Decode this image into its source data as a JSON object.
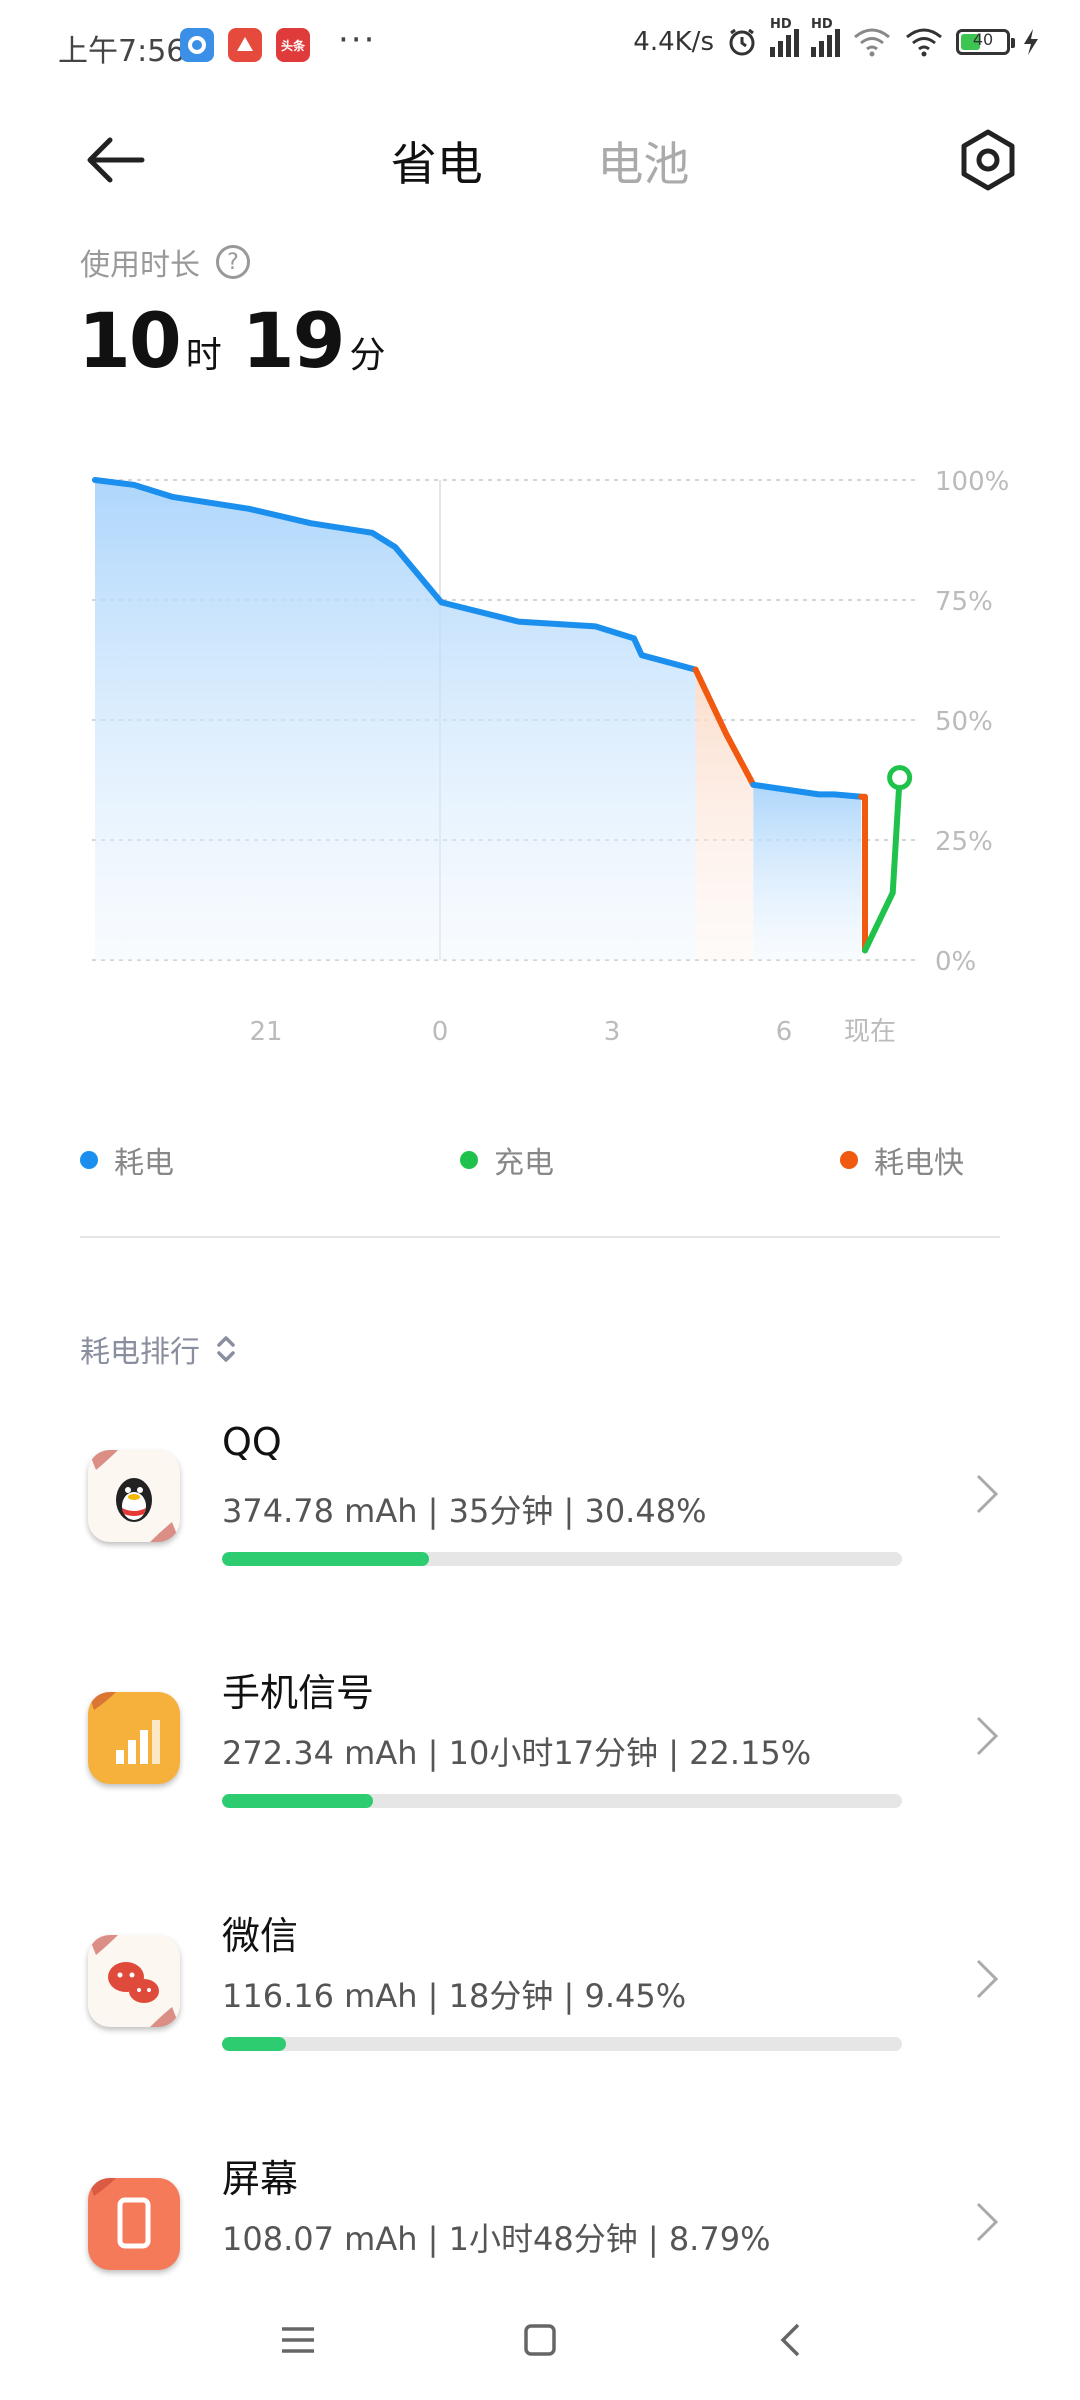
{
  "status_bar": {
    "time": "上午7:56",
    "network_speed": "4.4K/s",
    "battery_level": "40",
    "hd_label": "HD",
    "notification_apps": [
      {
        "icon": "browser-icon",
        "color": "#3b8fe6",
        "label": ""
      },
      {
        "icon": "game-icon",
        "color": "#e64a3c",
        "label": ""
      },
      {
        "icon": "toutiao-icon",
        "color": "#e03b3b",
        "label": "头条"
      }
    ],
    "more_indicator": "···"
  },
  "header": {
    "tabs": [
      {
        "label": "省电",
        "active": true
      },
      {
        "label": "电池",
        "active": false
      }
    ]
  },
  "usage": {
    "label": "使用时长",
    "hours": "10",
    "hours_unit": "时",
    "minutes": "19",
    "minutes_unit": "分"
  },
  "chart_data": {
    "type": "area",
    "y_ticks": [
      "100%",
      "75%",
      "50%",
      "25%",
      "0%"
    ],
    "x_ticks": [
      "21",
      "0",
      "3",
      "6",
      "现在"
    ],
    "ylim": [
      0,
      100
    ],
    "series": [
      {
        "name": "耗电",
        "color": "#1a8fee",
        "points": [
          [
            0,
            100
          ],
          [
            0.05,
            99
          ],
          [
            0.1,
            96.5
          ],
          [
            0.2,
            94
          ],
          [
            0.28,
            91
          ],
          [
            0.36,
            89
          ],
          [
            0.39,
            86
          ],
          [
            0.45,
            74.5
          ],
          [
            0.55,
            70.5
          ],
          [
            0.65,
            69.5
          ],
          [
            0.7,
            67
          ],
          [
            0.71,
            63.5
          ],
          [
            0.78,
            60.5
          ]
        ]
      },
      {
        "name": "耗电快",
        "color": "#f0590f",
        "points": [
          [
            0.78,
            60.5
          ],
          [
            0.82,
            47
          ],
          [
            0.855,
            36.5
          ]
        ]
      },
      {
        "name": "耗电",
        "color": "#1a8fee",
        "points": [
          [
            0.855,
            36.5
          ],
          [
            0.94,
            34.5
          ],
          [
            0.96,
            34.5
          ],
          [
            0.995,
            34
          ]
        ]
      },
      {
        "name": "耗电快",
        "color": "#f0590f",
        "points": [
          [
            0.995,
            34
          ],
          [
            1.0,
            34
          ],
          [
            1.0,
            2
          ]
        ]
      },
      {
        "name": "充电",
        "color": "#1fc24a",
        "points": [
          [
            1.0,
            2
          ],
          [
            1.036,
            14
          ],
          [
            1.045,
            38
          ]
        ]
      }
    ]
  },
  "legend": [
    {
      "label": "耗电",
      "color": "#1a8fee"
    },
    {
      "label": "充电",
      "color": "#1fc24a"
    },
    {
      "label": "耗电快",
      "color": "#f0590f"
    }
  ],
  "ranking": {
    "title": "耗电排行",
    "apps": [
      {
        "name": "QQ",
        "detail": "374.78 mAh | 35分钟 | 30.48%",
        "percent": 30.48,
        "icon": "qq-icon",
        "icon_bg": "#fdf7f2"
      },
      {
        "name": "手机信号",
        "detail": "272.34 mAh | 10小时17分钟 | 22.15%",
        "percent": 22.15,
        "icon": "signal-icon",
        "icon_bg": "#f6b13d"
      },
      {
        "name": "微信",
        "detail": "116.16 mAh | 18分钟 | 9.45%",
        "percent": 9.45,
        "icon": "wechat-icon",
        "icon_bg": "#fdf7f2"
      },
      {
        "name": "屏幕",
        "detail": "108.07 mAh | 1小时48分钟 | 8.79%",
        "percent": 8.79,
        "icon": "screen-icon",
        "icon_bg": "#f47a5a"
      }
    ]
  }
}
